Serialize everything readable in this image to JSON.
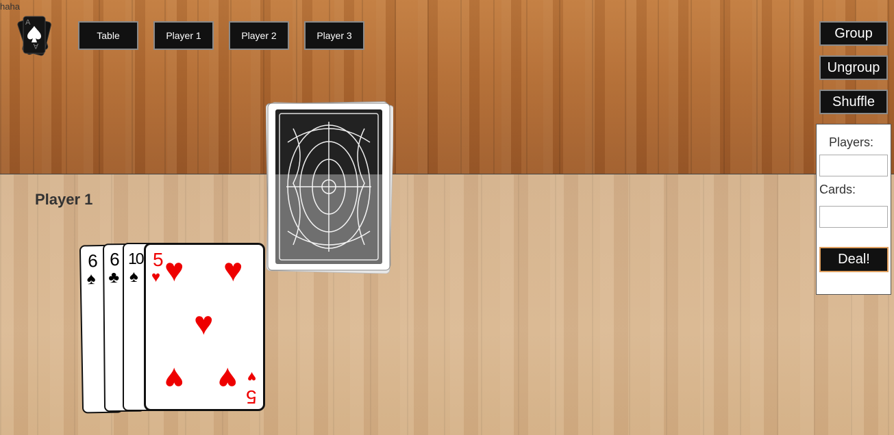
{
  "debug_text": "haha",
  "nav": {
    "tabs": [
      {
        "label": "Table"
      },
      {
        "label": "Player 1"
      },
      {
        "label": "Player 2"
      },
      {
        "label": "Player 3"
      }
    ]
  },
  "controls": {
    "group_label": "Group",
    "ungroup_label": "Ungroup",
    "shuffle_label": "Shuffle",
    "players_label": "Players:",
    "cards_label": "Cards:",
    "players_value": "",
    "cards_value": "",
    "deal_label": "Deal!"
  },
  "player_area": {
    "title": "Player 1",
    "hand": [
      {
        "rank": "6",
        "suit": "spades",
        "symbol": "♠",
        "color": "#000000"
      },
      {
        "rank": "6",
        "suit": "clubs",
        "symbol": "♣",
        "color": "#000000"
      },
      {
        "rank": "10",
        "suit": "spades",
        "symbol": "♠",
        "color": "#000000"
      },
      {
        "rank": "5",
        "suit": "hearts",
        "symbol": "♥",
        "color": "#ee0000"
      }
    ]
  },
  "deck": {
    "icon": "card-back-icon"
  },
  "logo": {
    "icon": "ace-of-spades-logo-icon"
  }
}
